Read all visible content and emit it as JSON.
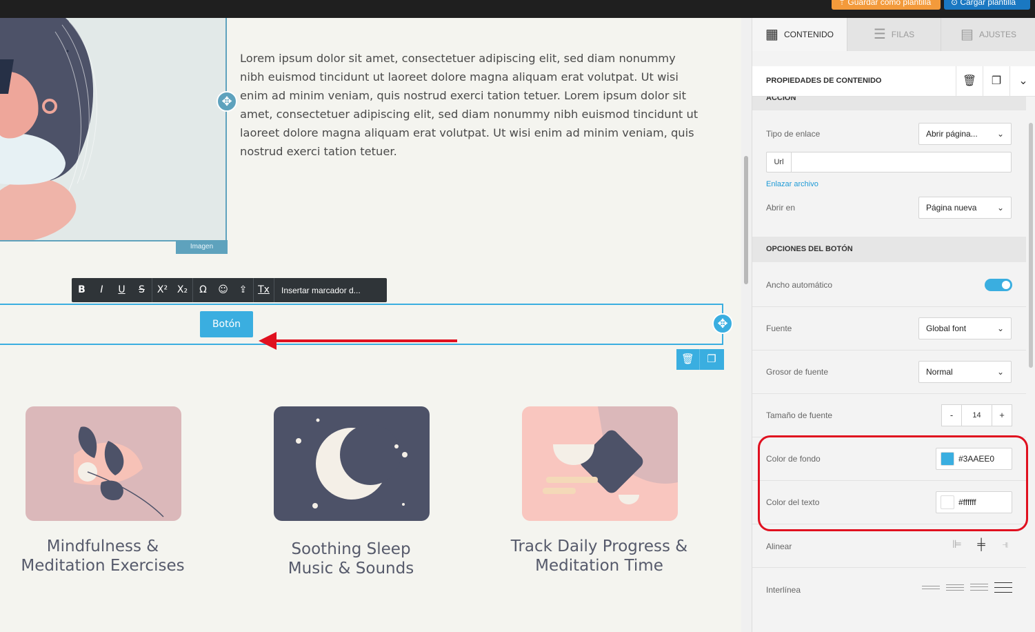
{
  "topbar": {
    "save_template_label": "Guardar como plantilla",
    "load_template_label": "Cargar plantilla"
  },
  "canvas": {
    "image_label": "Imagen",
    "paragraph": "Lorem ipsum dolor sit amet, consectetuer adipiscing elit, sed diam nonummy nibh euismod tincidunt ut laoreet dolore magna aliquam erat volutpat. Ut wisi enim ad minim veniam, quis nostrud exerci tation tetuer. Lorem ipsum dolor sit amet, consectetuer adipiscing elit, sed diam nonummy nibh euismod tincidunt ut laoreet dolore magna aliquam erat volutpat. Ut wisi enim ad minim veniam, quis nostrud exerci tation tetuer.",
    "toolbar": {
      "bold": "B",
      "italic": "I",
      "underline": "U",
      "strike": "S",
      "superscript": "X²",
      "subscript": "X₂",
      "special_char": "Ω",
      "emoji": "☺",
      "upload": "⇪",
      "clear_format": "Tx",
      "merge_tag": "Insertar marcador d..."
    },
    "button_text": "Botón",
    "features": [
      {
        "line1": "Mindfulness &",
        "line2": "Meditation Exercises"
      },
      {
        "line1": "Soothing Sleep",
        "line2": "Music & Sounds"
      },
      {
        "line1": "Track Daily Progress &",
        "line2": "Meditation Time"
      }
    ]
  },
  "panel": {
    "tabs": [
      {
        "label": "CONTENIDO",
        "icon": "grid-icon"
      },
      {
        "label": "FILAS",
        "icon": "rows-icon"
      },
      {
        "label": "AJUSTES",
        "icon": "settings-list-icon"
      }
    ],
    "props_title": "PROPIEDADES DE CONTENIDO",
    "action_section": "ACCIÓN",
    "link_type_label": "Tipo de enlace",
    "link_type_value": "Abrir página...",
    "url_label": "Url",
    "url_value": "",
    "link_file": "Enlazar archivo",
    "open_in_label": "Abrir en",
    "open_in_value": "Página nueva",
    "button_options_section": "OPCIONES DEL BOTÓN",
    "auto_width_label": "Ancho automático",
    "auto_width_on": true,
    "font_label": "Fuente",
    "font_value": "Global font",
    "font_weight_label": "Grosor de fuente",
    "font_weight_value": "Normal",
    "font_size_label": "Tamaño de fuente",
    "font_size_minus": "-",
    "font_size_value": "14",
    "font_size_plus": "+",
    "bg_color_label": "Color de fondo",
    "bg_color_value": "#3AAEE0",
    "text_color_label": "Color del texto",
    "text_color_value": "#ffffff",
    "align_label": "Alinear",
    "line_height_label": "Interlínea"
  },
  "colors": {
    "accent": "#3AAEE0",
    "highlight": "#e0101f",
    "selection": "#5ea2bd"
  }
}
